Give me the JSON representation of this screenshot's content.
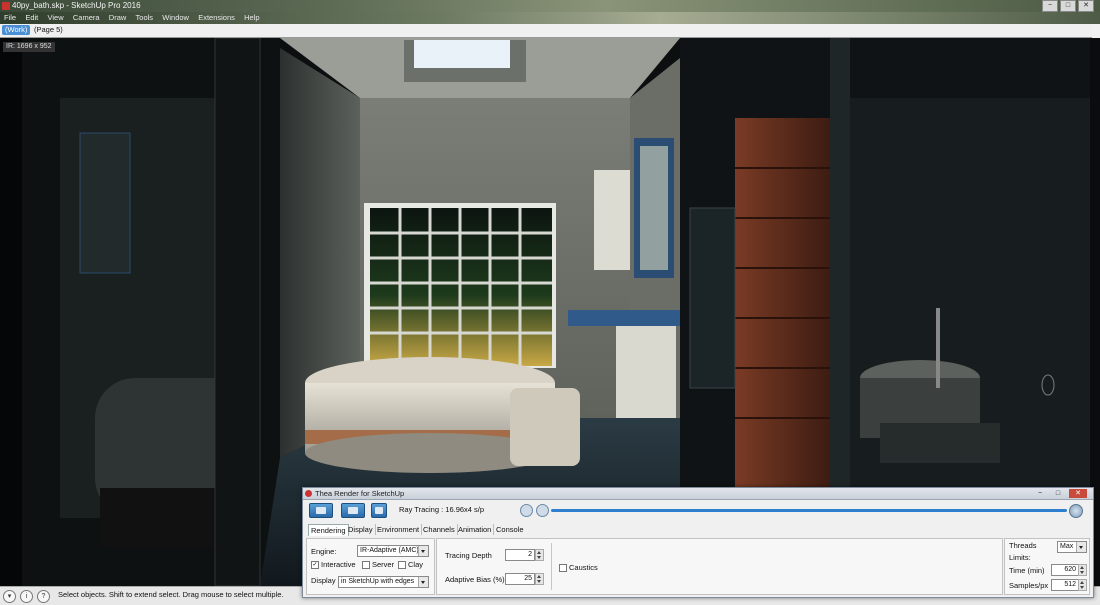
{
  "window": {
    "title": "40py_bath.skp - SketchUp Pro 2016",
    "controls": [
      "−",
      "□",
      "✕"
    ]
  },
  "menu": [
    "File",
    "Edit",
    "View",
    "Camera",
    "Draw",
    "Tools",
    "Window",
    "Extensions",
    "Help"
  ],
  "scene_tabs": [
    "(Work)",
    "(Page 5)"
  ],
  "viewport": {
    "size_label": "IR: 1696 x 952",
    "icon": "rendered-bathroom-scene"
  },
  "status": {
    "text": "Select objects. Shift to extend select. Drag mouse to select multiple.",
    "icons": [
      "geo-location-icon",
      "credits-icon",
      "help-icon"
    ]
  },
  "thea": {
    "title": "Thea Render for SketchUp",
    "controls": [
      "−",
      "□",
      "✕"
    ],
    "status": "Ray Tracing : 16.96x4 s/p",
    "tabs": [
      "Rendering",
      "Display",
      "Environment",
      "Channels",
      "Animation",
      "Console"
    ],
    "engine_label": "Engine:",
    "engine_value": "IR-Adaptive (AMC)",
    "interactive_label": "Interactive",
    "interactive_checked": true,
    "server_label": "Server",
    "clay_label": "Clay",
    "display_label": "Display",
    "display_value": "in SketchUp with edges",
    "tracing_depth_label": "Tracing Depth",
    "tracing_depth_value": "2",
    "adaptive_bias_label": "Adaptive Bias (%)",
    "adaptive_bias_value": "25",
    "caustics_label": "Caustics",
    "threads_label": "Threads",
    "threads_value": "Max",
    "limits_label": "Limits:",
    "time_label": "Time (min)",
    "time_value": "620",
    "samples_label": "Samples/px",
    "samples_value": "512"
  },
  "colors": {
    "accent": "#2f7fcf",
    "tab_active": "#4a8fd6"
  }
}
